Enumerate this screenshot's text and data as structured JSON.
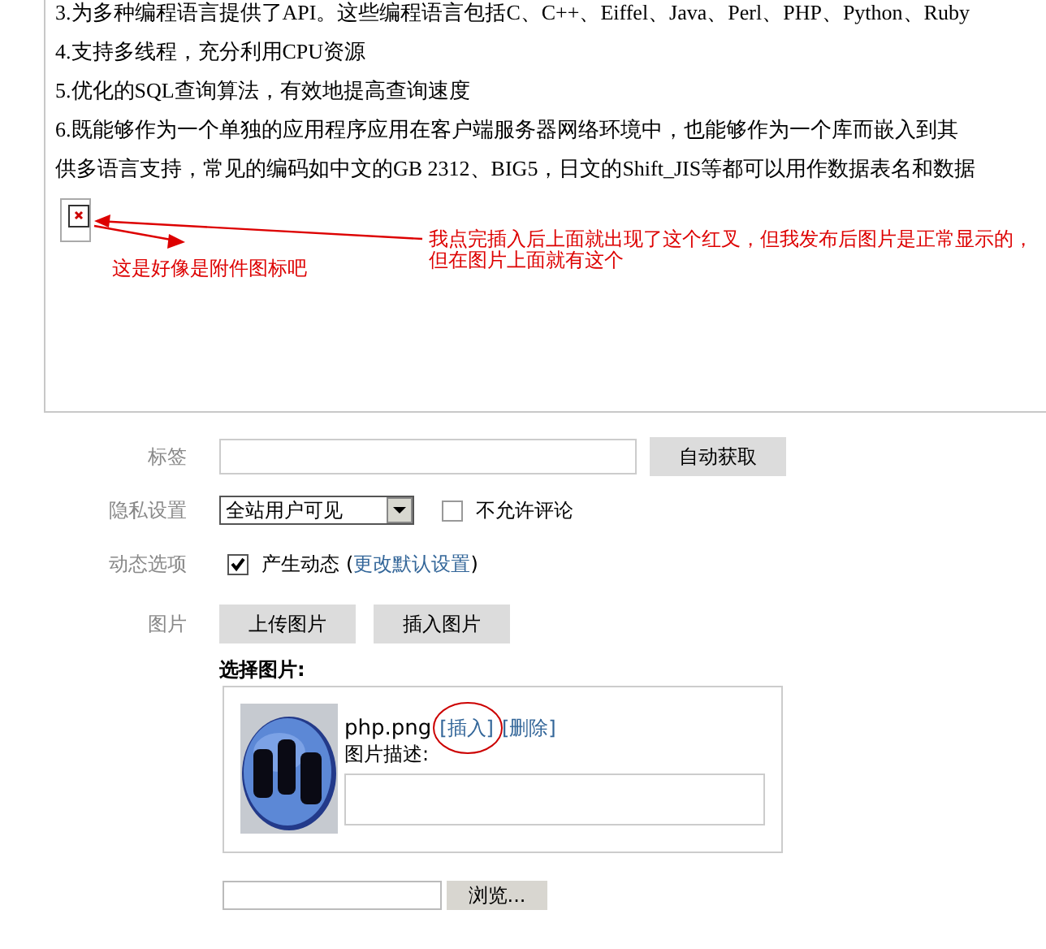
{
  "editor": {
    "lines": [
      "3.为多种编程语言提供了API。这些编程语言包括C、C++、Eiffel、Java、Perl、PHP、Python、Ruby",
      "4.支持多线程，充分利用CPU资源",
      "5.优化的SQL查询算法，有效地提高查询速度",
      "6.既能够作为一个单独的应用程序应用在客户端服务器网络环境中，也能够作为一个库而嵌入到其",
      "供多语言支持，常见的编码如中文的GB 2312、BIG5，日文的Shift_JIS等都可以用作数据表名和数据"
    ],
    "notes": [
      {
        "lines": [
          "我点完插入后上面就出现了这个红叉，但我发布后图片是正常显示的，",
          "但在图片上面就有这个"
        ]
      },
      {
        "lines": [
          "这是好像是附件图标吧"
        ]
      }
    ]
  },
  "form": {
    "rows": [
      {
        "kind": "tags",
        "label": "标签",
        "button": "自动获取"
      },
      {
        "kind": "privacy",
        "label": "隐私设置",
        "select": "全站用户可见",
        "checkbox": {
          "label": "不允许评论",
          "checked": false
        }
      },
      {
        "kind": "feed",
        "label": "动态选项",
        "checkbox": {
          "label": "产生动态",
          "checked": true
        },
        "open": "(",
        "link": "更改默认设置",
        "close": ")"
      },
      {
        "kind": "images",
        "label": "图片",
        "buttons": [
          "上传图片",
          "插入图片"
        ]
      }
    ]
  },
  "picker": {
    "title": "选择图片:",
    "files": [
      {
        "name": "php.png",
        "actions": [
          {
            "label": "[插入]",
            "circled": true
          },
          {
            "label": "[删除]",
            "circled": false
          }
        ],
        "description_label": "图片描述:"
      }
    ]
  },
  "browse": {
    "button": "浏览..."
  }
}
